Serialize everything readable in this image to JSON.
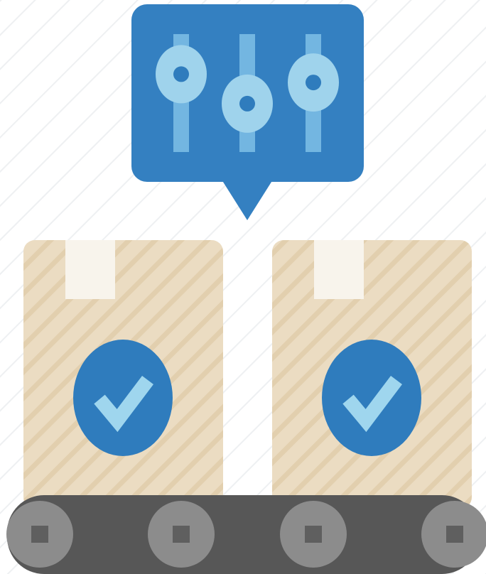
{
  "icon": {
    "name": "conveyor-quality-control-icon",
    "settings_bubble": {
      "icon": "sliders-icon",
      "slider_levels": [
        0.66,
        0.41,
        0.59
      ]
    },
    "boxes": [
      {
        "icon": "package-box-icon",
        "status_icon": "checkmark-icon",
        "status": "approved"
      },
      {
        "icon": "package-box-icon",
        "status_icon": "checkmark-icon",
        "status": "approved"
      }
    ],
    "conveyor": {
      "icon": "conveyor-belt-icon",
      "roller_count": 4
    }
  },
  "colors": {
    "background": "#ffffff",
    "background_stripe": "#eef0f2",
    "bubble": "#3480c1",
    "slider_track": "#73b6e1",
    "slider_knob": "#9fd3ec",
    "slider_knob_center": "#2f7cbd",
    "box": "#ebdcc2",
    "box_stripe": "#e2cfae",
    "box_tape": "#f8f4ec",
    "check_badge": "#2f7cbd",
    "check_mark": "#9fd6ee",
    "belt": "#575757",
    "roller": "#8c8c8c",
    "roller_hub": "#5f5f5f"
  }
}
